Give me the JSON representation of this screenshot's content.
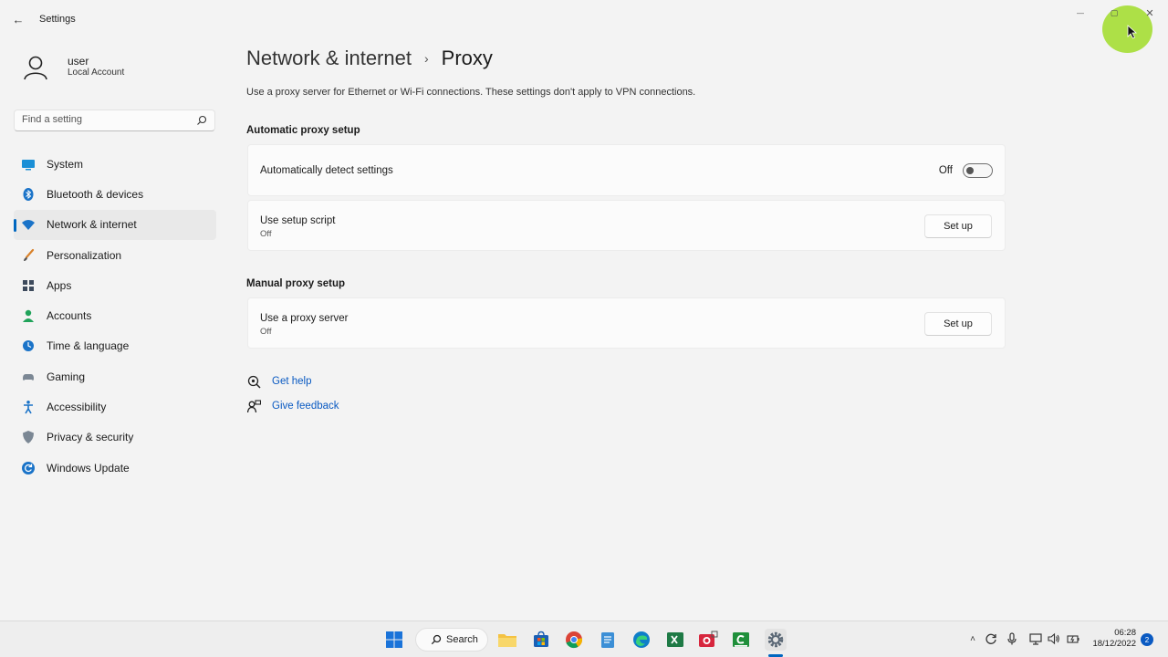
{
  "window": {
    "app_title": "Settings",
    "back_glyph": "←",
    "minimize_glyph": "—",
    "maximize_glyph": "▢",
    "close_glyph": "✕"
  },
  "user": {
    "name": "user",
    "account_type": "Local Account"
  },
  "search": {
    "placeholder": "Find a setting"
  },
  "sidebar": {
    "items": [
      {
        "label": "System",
        "icon": "monitor-icon",
        "active": false
      },
      {
        "label": "Bluetooth & devices",
        "icon": "bluetooth-icon",
        "active": false
      },
      {
        "label": "Network & internet",
        "icon": "wifi-icon",
        "active": true
      },
      {
        "label": "Personalization",
        "icon": "brush-icon",
        "active": false
      },
      {
        "label": "Apps",
        "icon": "apps-icon",
        "active": false
      },
      {
        "label": "Accounts",
        "icon": "person-icon",
        "active": false
      },
      {
        "label": "Time & language",
        "icon": "globe-clock-icon",
        "active": false
      },
      {
        "label": "Gaming",
        "icon": "gamepad-icon",
        "active": false
      },
      {
        "label": "Accessibility",
        "icon": "accessibility-icon",
        "active": false
      },
      {
        "label": "Privacy & security",
        "icon": "shield-icon",
        "active": false
      },
      {
        "label": "Windows Update",
        "icon": "update-icon",
        "active": false
      }
    ]
  },
  "main": {
    "breadcrumb_parent": "Network & internet",
    "breadcrumb_separator": "›",
    "breadcrumb_current": "Proxy",
    "description": "Use a proxy server for Ethernet or Wi-Fi connections. These settings don't apply to VPN connections.",
    "automatic": {
      "section_title": "Automatic proxy setup",
      "detect": {
        "title": "Automatically detect settings",
        "toggle_state_label": "Off",
        "toggle_on": false
      },
      "script": {
        "title": "Use setup script",
        "status": "Off",
        "button_label": "Set up"
      }
    },
    "manual": {
      "section_title": "Manual proxy setup",
      "proxy_server": {
        "title": "Use a proxy server",
        "status": "Off",
        "button_label": "Set up"
      }
    },
    "help_links": {
      "get_help": "Get help",
      "give_feedback": "Give feedback"
    }
  },
  "taskbar": {
    "search_label": "Search",
    "apps": [
      "windows-start-icon",
      "file-explorer-icon",
      "store-icon",
      "chrome-icon",
      "notepad-icon",
      "edge-icon",
      "excel-icon",
      "camera-app-icon",
      "cmd-icon",
      "settings-icon"
    ],
    "tray": {
      "chevron_glyph": "˄",
      "clock_time": "06:28",
      "clock_date": "18/12/2022",
      "notification_count": "2"
    }
  },
  "colors": {
    "accent": "#0067c0",
    "link": "#0a5ac2",
    "background": "#f3f3f3",
    "card": "#fbfbfb",
    "cursor_highlight": "#a0dc28"
  }
}
